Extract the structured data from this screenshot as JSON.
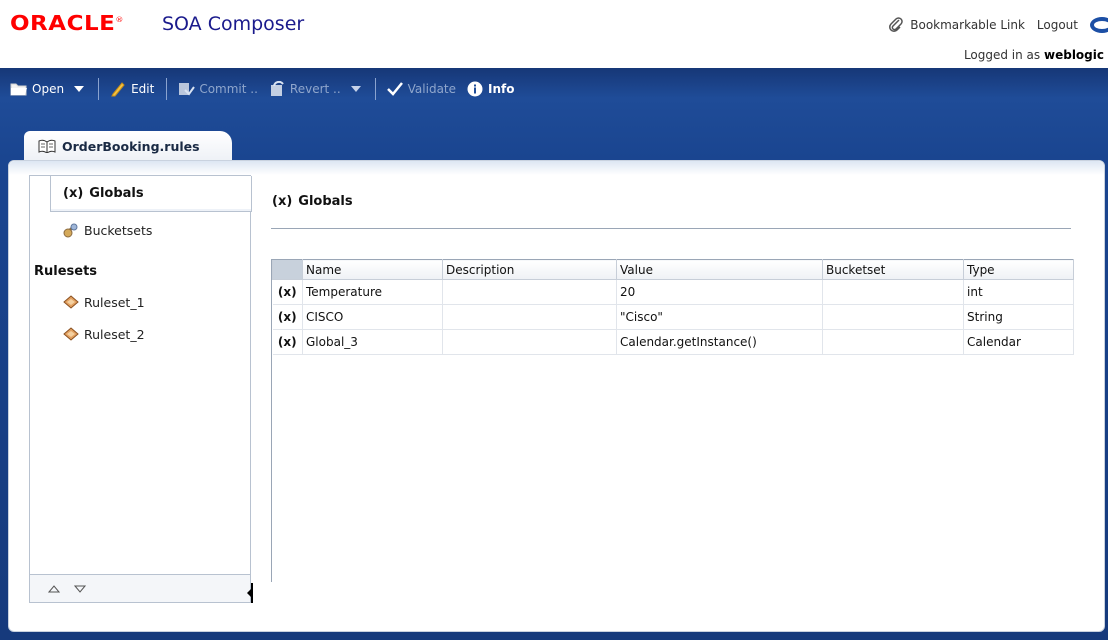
{
  "header": {
    "brand": "ORACLE",
    "app_title": "SOA Composer",
    "bookmarkable_link": "Bookmarkable Link",
    "logout": "Logout",
    "logged_in_prefix": "Logged in as",
    "username": "weblogic"
  },
  "toolbar": {
    "open": "Open",
    "edit": "Edit",
    "commit": "Commit ..",
    "revert": "Revert ..",
    "validate": "Validate",
    "info": "Info"
  },
  "tab": {
    "label": "OrderBooking.rules"
  },
  "navigator": {
    "globals": "Globals",
    "bucketsets": "Bucketsets",
    "rulesets_heading": "Rulesets",
    "rulesets": [
      "Ruleset_1",
      "Ruleset_2"
    ]
  },
  "content": {
    "variable_marker": "(x)",
    "title": "Globals",
    "columns": [
      "Name",
      "Description",
      "Value",
      "Bucketset",
      "Type"
    ],
    "rows": [
      {
        "marker": "(x)",
        "name": "Temperature",
        "description": "",
        "value": "20",
        "bucketset": "",
        "type": "int"
      },
      {
        "marker": "(x)",
        "name": "CISCO",
        "description": "",
        "value": "\"Cisco\"",
        "bucketset": "",
        "type": "String"
      },
      {
        "marker": "(x)",
        "name": "Global_3",
        "description": "",
        "value": "Calendar.getInstance()",
        "bucketset": "",
        "type": "Calendar"
      }
    ]
  },
  "colors": {
    "brand_red": "#ff0000",
    "title_blue": "#1a1a8c",
    "band_blue": "#1f4c98"
  }
}
